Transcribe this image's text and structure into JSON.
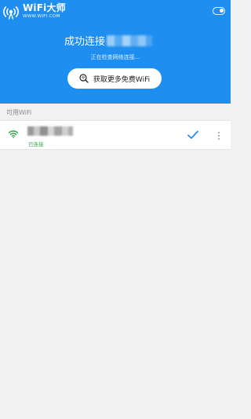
{
  "header": {
    "title": "WiFi大师",
    "subtitle": "WWW.WIFI.COM",
    "logo_icon": "wifi-master-logo-icon",
    "toggle_icon": "toggle-icon"
  },
  "status": {
    "title": "成功连接",
    "subtitle": "正在检查网络连接..."
  },
  "get_more_button": {
    "label": "获取更多免费WiFi",
    "icon": "search-wifi-icon"
  },
  "section": {
    "label": "可用WiFi"
  },
  "wifi_list": [
    {
      "status": "已连接",
      "signal_icon": "wifi-signal-icon",
      "selected_icon": "checkmark-icon",
      "more_icon": "more-vertical-icon"
    }
  ],
  "colors": {
    "primary": "#1e8ff0",
    "connected_green": "#2aa74a",
    "background": "#f1f1f1"
  }
}
